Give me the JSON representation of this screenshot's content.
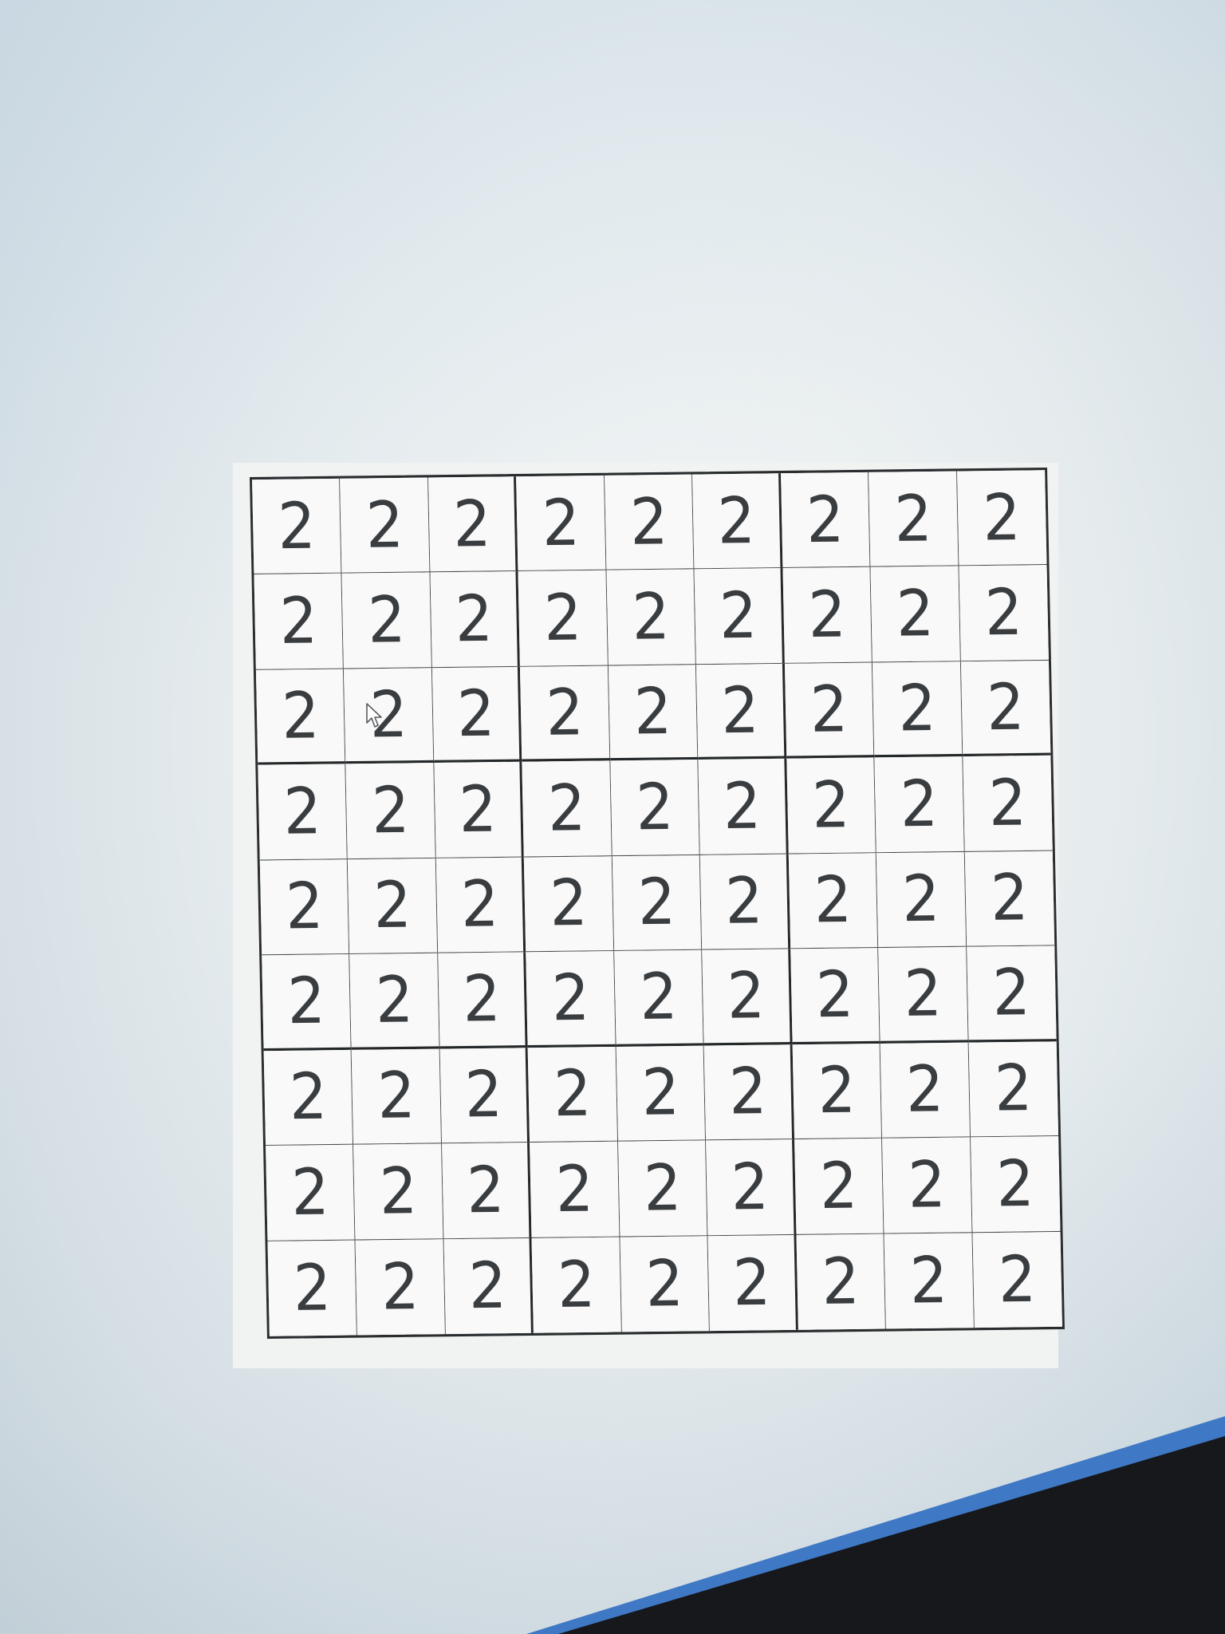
{
  "sudoku": {
    "rows": [
      [
        "2",
        "2",
        "2",
        "2",
        "2",
        "2",
        "2",
        "2",
        "2"
      ],
      [
        "2",
        "2",
        "2",
        "2",
        "2",
        "2",
        "2",
        "2",
        "2"
      ],
      [
        "2",
        "2",
        "2",
        "2",
        "2",
        "2",
        "2",
        "2",
        "2"
      ],
      [
        "2",
        "2",
        "2",
        "2",
        "2",
        "2",
        "2",
        "2",
        "2"
      ],
      [
        "2",
        "2",
        "2",
        "2",
        "2",
        "2",
        "2",
        "2",
        "2"
      ],
      [
        "2",
        "2",
        "2",
        "2",
        "2",
        "2",
        "2",
        "2",
        "2"
      ],
      [
        "2",
        "2",
        "2",
        "2",
        "2",
        "2",
        "2",
        "2",
        "2"
      ],
      [
        "2",
        "2",
        "2",
        "2",
        "2",
        "2",
        "2",
        "2",
        "2"
      ],
      [
        "2",
        "2",
        "2",
        "2",
        "2",
        "2",
        "2",
        "2",
        "2"
      ]
    ]
  },
  "cursor": {
    "icon": "arrow-pointer-icon"
  },
  "taskbar": {
    "accent_color": "#3f78c4"
  }
}
